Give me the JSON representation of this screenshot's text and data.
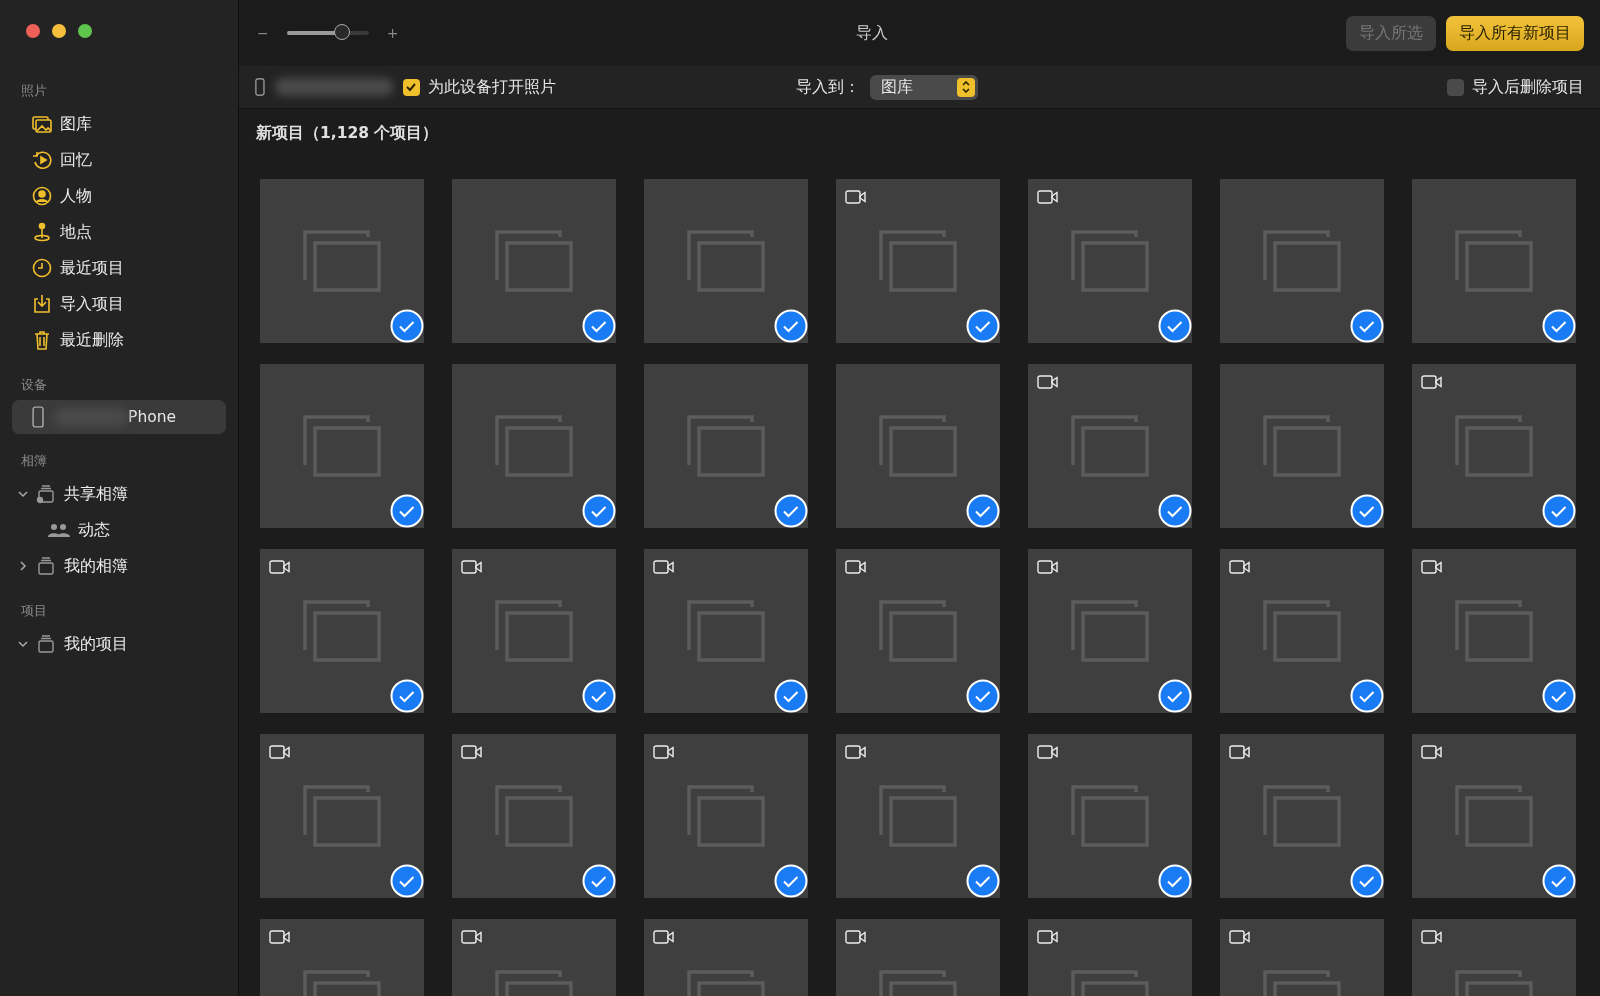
{
  "sidebar": {
    "sections": [
      {
        "title": "照片",
        "items": [
          {
            "label": "图库"
          },
          {
            "label": "回忆"
          },
          {
            "label": "人物"
          },
          {
            "label": "地点"
          },
          {
            "label": "最近项目"
          },
          {
            "label": "导入项目"
          },
          {
            "label": "最近删除"
          }
        ]
      },
      {
        "title": "设备",
        "devices": [
          {
            "label": "Phone",
            "selected": true
          }
        ]
      },
      {
        "title": "相簿",
        "tree": [
          {
            "label": "共享相簿",
            "expanded": true,
            "children": [
              {
                "label": "动态"
              }
            ]
          },
          {
            "label": "我的相簿",
            "expanded": false
          }
        ]
      },
      {
        "title": "项目",
        "tree": [
          {
            "label": "我的项目",
            "expanded": true
          }
        ]
      }
    ]
  },
  "toolbar": {
    "zoom_minus": "−",
    "zoom_plus": "+",
    "zoom": {
      "level": 0.67
    },
    "title": "导入",
    "buttons": [
      {
        "label": "导入所选",
        "kind": "secondary",
        "disabled": true
      },
      {
        "label": "导入所有新项目",
        "kind": "primary",
        "disabled": false
      }
    ]
  },
  "device_bar": {
    "open_photos": {
      "label": "为此设备打开照片",
      "checked": true
    },
    "import_to_label": "导入到：",
    "import_to": {
      "value": "图库"
    },
    "delete_after": {
      "label": "导入后删除项目",
      "checked": false
    }
  },
  "heading": "新项目（1,128 个项目）",
  "tiles": [
    {
      "video": false,
      "checked": true
    },
    {
      "video": false,
      "checked": true
    },
    {
      "video": false,
      "checked": true
    },
    {
      "video": true,
      "checked": true
    },
    {
      "video": true,
      "checked": true
    },
    {
      "video": false,
      "checked": true
    },
    {
      "video": false,
      "checked": true
    },
    {
      "video": false,
      "checked": true
    },
    {
      "video": false,
      "checked": true
    },
    {
      "video": false,
      "checked": true
    },
    {
      "video": false,
      "checked": true
    },
    {
      "video": true,
      "checked": true
    },
    {
      "video": false,
      "checked": true
    },
    {
      "video": true,
      "checked": true
    },
    {
      "video": true,
      "checked": true
    },
    {
      "video": true,
      "checked": true
    },
    {
      "video": true,
      "checked": true
    },
    {
      "video": true,
      "checked": true
    },
    {
      "video": true,
      "checked": true
    },
    {
      "video": true,
      "checked": true
    },
    {
      "video": true,
      "checked": true
    },
    {
      "video": true,
      "checked": true
    },
    {
      "video": true,
      "checked": true
    },
    {
      "video": true,
      "checked": true
    },
    {
      "video": true,
      "checked": true
    },
    {
      "video": true,
      "checked": true
    },
    {
      "video": true,
      "checked": true
    },
    {
      "video": true,
      "checked": true
    },
    {
      "video": true
    },
    {
      "video": true
    },
    {
      "video": true
    },
    {
      "video": true
    },
    {
      "video": true
    },
    {
      "video": true
    },
    {
      "video": true
    }
  ]
}
